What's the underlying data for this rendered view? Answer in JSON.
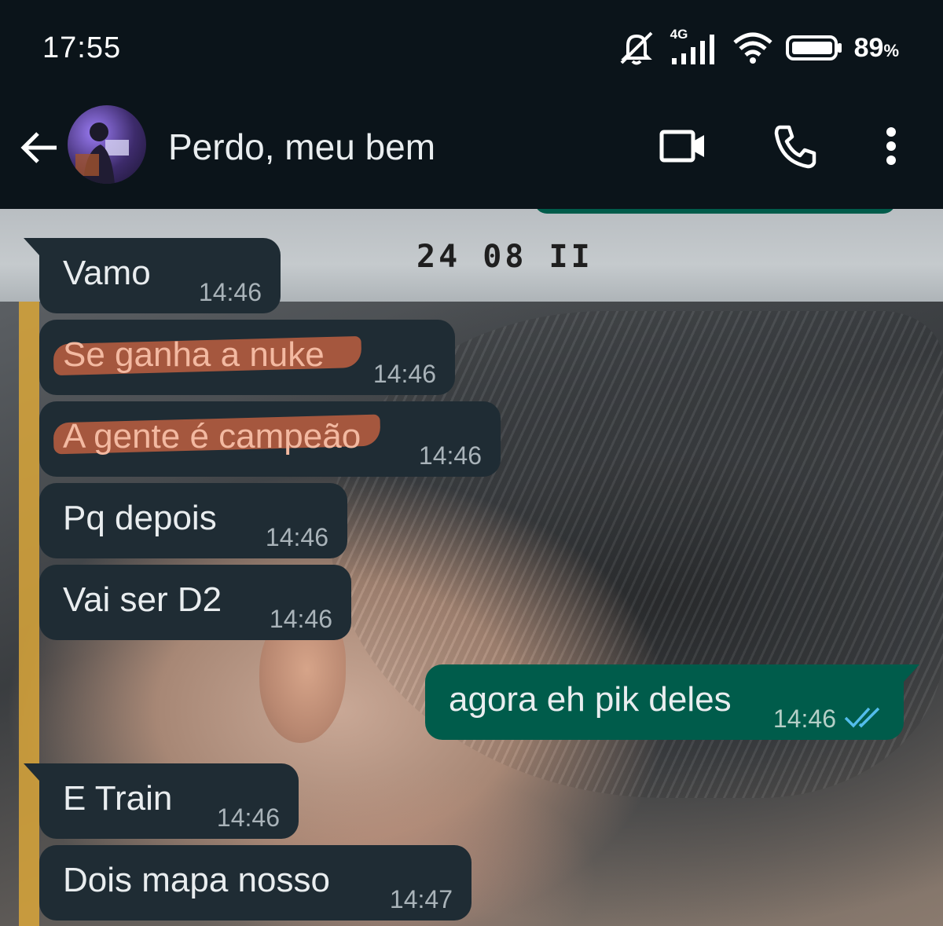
{
  "status_bar": {
    "time": "17:55",
    "network": "4G",
    "battery_percent": "89",
    "battery_unit": "%",
    "icons": [
      "mute-icon",
      "signal-icon",
      "wifi-icon",
      "battery-icon"
    ]
  },
  "header": {
    "contact_name": "Perdo, meu bem",
    "icons": [
      "back-arrow-icon",
      "video-call-icon",
      "voice-call-icon",
      "more-options-icon"
    ]
  },
  "wallpaper": {
    "stamp_text": "24 08 II"
  },
  "messages": [
    {
      "direction": "in",
      "text": "Vamo",
      "time": "14:46"
    },
    {
      "direction": "in",
      "text": "Se ganha a nuke",
      "time": "14:46",
      "highlighted": true
    },
    {
      "direction": "in",
      "text": "A gente é campeão",
      "time": "14:46",
      "highlighted": true
    },
    {
      "direction": "in",
      "text": "Pq depois",
      "time": "14:46"
    },
    {
      "direction": "in",
      "text": "Vai ser D2",
      "time": "14:46"
    },
    {
      "direction": "out",
      "text": "agora eh pik deles",
      "time": "14:46",
      "status": "read"
    },
    {
      "direction": "in",
      "text": "E Train",
      "time": "14:46"
    },
    {
      "direction": "in",
      "text": "Dois mapa nosso",
      "time": "14:47"
    }
  ],
  "colors": {
    "background": "#0b141a",
    "incoming_bubble": "#1f2c34",
    "outgoing_bubble": "#005c4b",
    "read_ticks": "#53bdeb",
    "highlight": "#d96842"
  }
}
